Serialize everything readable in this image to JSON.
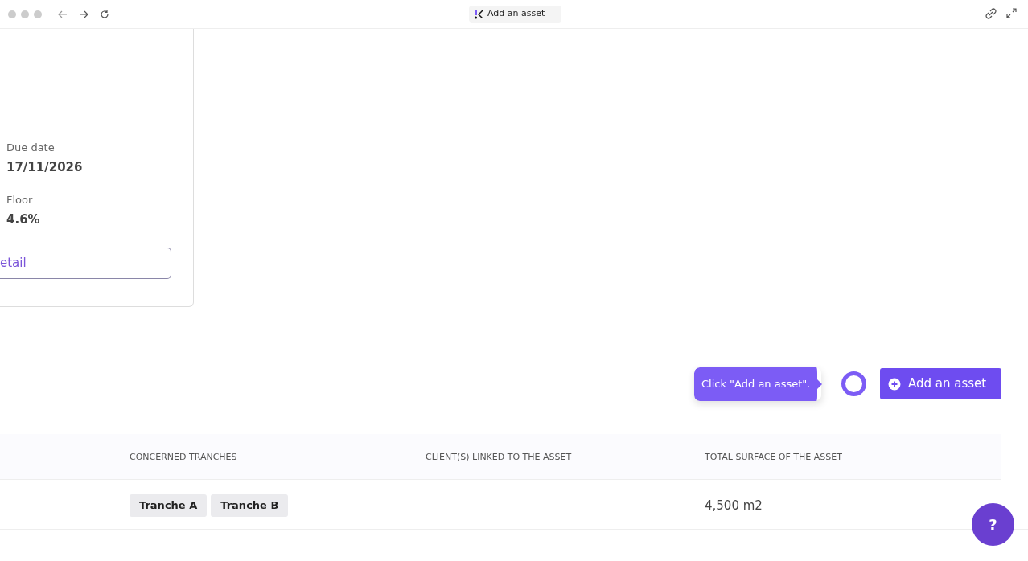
{
  "window": {
    "title": "Add an asset"
  },
  "card": {
    "fields": [
      {
        "label": "Due date",
        "value": "17/11/2026"
      },
      {
        "label": "Floor",
        "value": "4.6%"
      }
    ],
    "button": "etail"
  },
  "tooltip": {
    "text": "Click \"Add an asset\"."
  },
  "add_button": {
    "label": "Add an asset"
  },
  "table": {
    "columns": [
      "CONCERNED TRANCHES",
      "CLIENT(S) LINKED TO THE ASSET",
      "TOTAL SURFACE OF THE ASSET"
    ],
    "rows": [
      {
        "tranches": [
          "Tranche A",
          "Tranche B"
        ],
        "clients": "",
        "surface": "4,500 m2"
      }
    ]
  },
  "help_button": {
    "label": "?"
  }
}
